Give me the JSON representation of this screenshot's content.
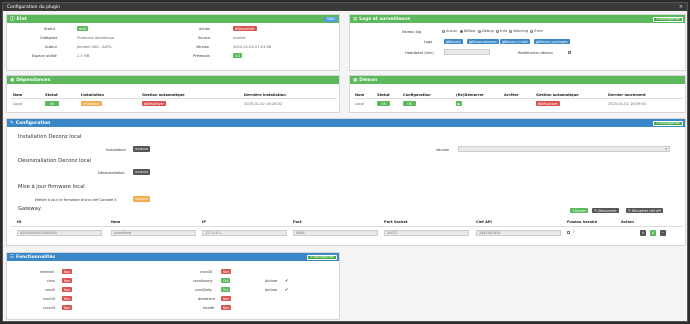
{
  "modal": {
    "title": "Configuration du plugin",
    "close": "×"
  },
  "etat": {
    "title": "Etat",
    "header_btn": "Wiki",
    "rows": [
      {
        "label": "Statut",
        "value": "Actif"
      },
      {
        "label": "Catégorie",
        "value": "Protocole domotique"
      },
      {
        "label": "Auteur",
        "value": "Jeedom SAS - AGPL"
      },
      {
        "label": "Espace utilisé",
        "value": "2.5 MB"
      }
    ],
    "rrows": [
      {
        "label": "Action",
        "value": "Désactiver"
      },
      {
        "label": "Source",
        "value": "market"
      },
      {
        "label": "Version",
        "value": "2024-01-04 01:01:08"
      },
      {
        "label": "Prérequis",
        "value": "4.4"
      }
    ]
  },
  "logs": {
    "title": "Logs et surveillance",
    "header_btn": "Sauvegarder",
    "niveau_label": "Niveau log",
    "levels": [
      "Aucun",
      "Défaut",
      "Debug",
      "Info",
      "Warning",
      "Error"
    ],
    "selected_level": "Défaut",
    "logs_label": "Logs",
    "log_buttons": [
      "Deconz",
      "Deconzdaemon",
      "Deconz_install",
      "Deconz_packages"
    ],
    "heartbeat_label": "Heartbeat (min)",
    "restart_label": "Redémarrer démon"
  },
  "dependances": {
    "title": "Dépendances",
    "headers": [
      "Nom",
      "Statut",
      "Installation",
      "Gestion automatique",
      "Dernière installation"
    ],
    "row": {
      "nom": "Local",
      "statut": "OK",
      "installation": "Relancer",
      "gestion": "Désactiver",
      "derniere": "2025-01-02 16:28:02"
    }
  },
  "demon": {
    "title": "Démon",
    "headers": [
      "Nom",
      "Statut",
      "Configuration",
      "(Re)Démarrer",
      "Arrêter",
      "Gestion automatique",
      "Dernier lancement"
    ],
    "row": {
      "nom": "Local",
      "statut": "OK",
      "configuration": "OK",
      "gestion": "Désactiver",
      "dernier": "2025-01-02 16:39:03"
    }
  },
  "configuration": {
    "title": "Configuration",
    "header_btn": "Sauvegarder",
    "install_title": "Installation Deconz local",
    "install_label": "Installation",
    "install_btn": "Lancer",
    "version_label": "Version",
    "uninstall_title": "Désinstallation Deconz local",
    "uninstall_label": "Désinstallation",
    "uninstall_btn": "Lancer",
    "firmware_title": "Mise à jour firmware local",
    "firmware_label": "Mettre à jour le firmware d'une clef Conbee II",
    "firmware_btn": "Lancer",
    "gateway_title": "Gateway",
    "gateway_buttons": [
      "Ajouter",
      "Découverte",
      "Récupérer clef API"
    ],
    "table_headers": [
      "ID",
      "Nom",
      "IP",
      "Port",
      "Port Socket",
      "Clef API",
      "Fuseau horaire",
      "Action"
    ],
    "gateway_row": {
      "id": "00000000000000000",
      "nom": "undefined",
      "ip": "127.0.0.1",
      "port": "8484",
      "port_socket": "20077",
      "clef": "33819D362F"
    }
  },
  "fonctionnalites": {
    "title": "Fonctionnalités",
    "header_btn": "Sauvegarder",
    "left": [
      {
        "label": "interact",
        "value": "Non"
      },
      {
        "label": "cron",
        "value": "Non"
      },
      {
        "label": "cron5",
        "value": "Non"
      },
      {
        "label": "cron10",
        "value": "Non"
      },
      {
        "label": "cron15",
        "value": "Non"
      }
    ],
    "right": [
      {
        "label": "cron30",
        "value": "Non"
      },
      {
        "label": "cronHourly",
        "value": "Oui",
        "extra": "Activer"
      },
      {
        "label": "cronDaily",
        "value": "Oui",
        "extra": "Activer"
      },
      {
        "label": "deadcmd",
        "value": "Non"
      },
      {
        "label": "health",
        "value": "Non"
      }
    ]
  }
}
